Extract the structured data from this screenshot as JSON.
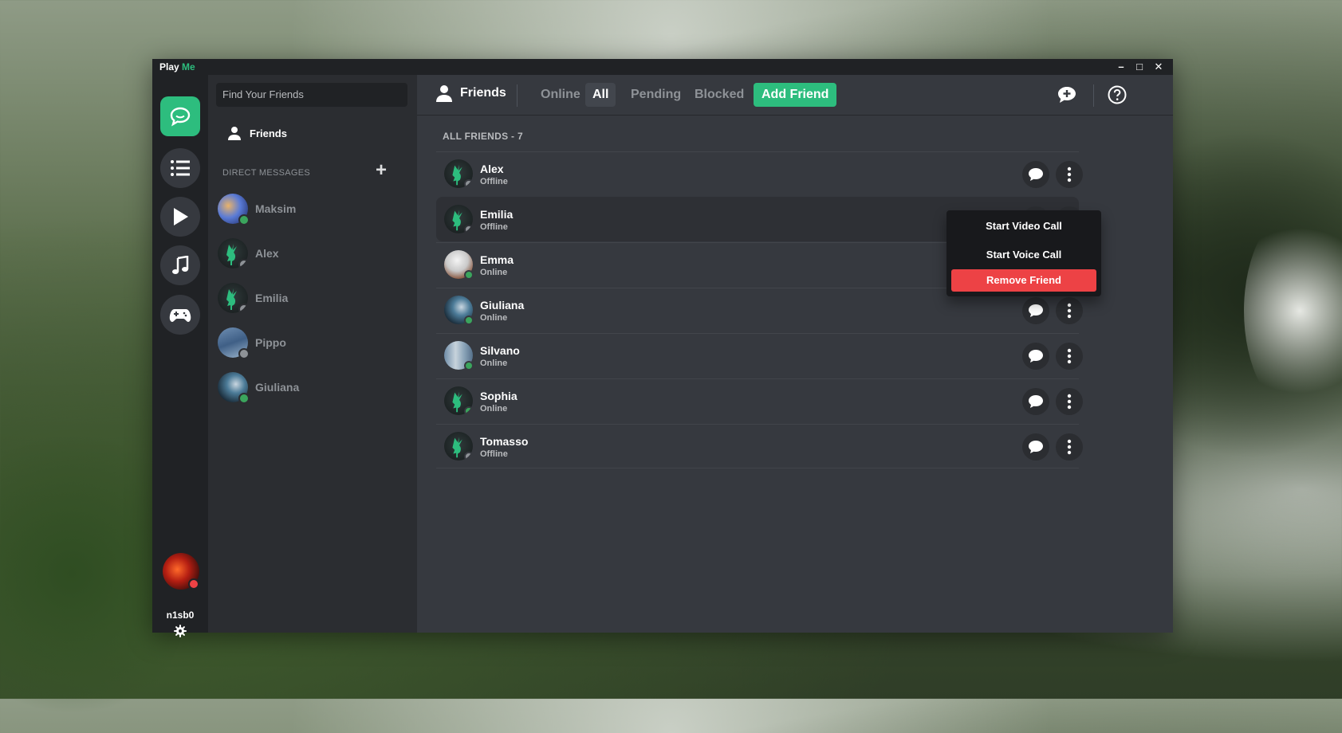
{
  "window": {
    "title_prefix": "Play",
    "title_accent": "Me",
    "controls": {
      "minimize": "–",
      "maximize": "□",
      "close": "✕"
    }
  },
  "rail": {
    "items": [
      {
        "icon": "chat-bubbles-icon",
        "active": true
      },
      {
        "icon": "list-icon",
        "active": false
      },
      {
        "icon": "play-icon",
        "active": false
      },
      {
        "icon": "music-note-icon",
        "active": false
      },
      {
        "icon": "gamepad-icon",
        "active": false
      }
    ],
    "username": "n1sb0",
    "user_status_color": "#ed4245"
  },
  "sidebar": {
    "search_placeholder": "Find Your Friends",
    "friends_label": "Friends",
    "dm_header": "DIRECT MESSAGES",
    "dm_add": "+",
    "dms": [
      {
        "name": "Maksim",
        "status": "online"
      },
      {
        "name": "Alex",
        "status": "offline"
      },
      {
        "name": "Emilia",
        "status": "offline"
      },
      {
        "name": "Pippo",
        "status": "offline"
      },
      {
        "name": "Giuliana",
        "status": "online"
      }
    ]
  },
  "topbar": {
    "friends_label": "Friends",
    "tabs": [
      "Online",
      "All",
      "Pending",
      "Blocked"
    ],
    "active_tab": "All",
    "add_friend": "Add Friend"
  },
  "friends": {
    "header": "ALL FRIENDS - 7",
    "list": [
      {
        "name": "Alex",
        "status": "Offline"
      },
      {
        "name": "Emilia",
        "status": "Offline"
      },
      {
        "name": "Emma",
        "status": "Online"
      },
      {
        "name": "Giuliana",
        "status": "Online"
      },
      {
        "name": "Silvano",
        "status": "Online"
      },
      {
        "name": "Sophia",
        "status": "Online"
      },
      {
        "name": "Tomasso",
        "status": "Offline"
      }
    ]
  },
  "context_menu": {
    "items": [
      "Start Video Call",
      "Start Voice Call",
      "Remove Friend"
    ]
  },
  "colors": {
    "accent": "#2dbd7e",
    "danger": "#ed4245",
    "online": "#3ba55d",
    "offline": "#8e9297"
  }
}
